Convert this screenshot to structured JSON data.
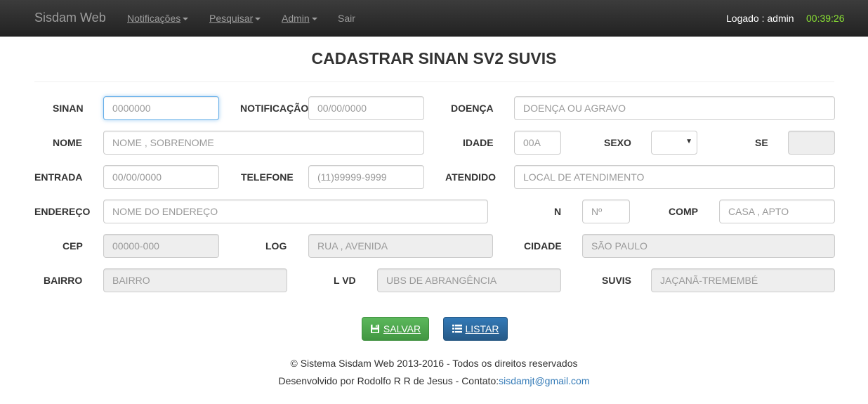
{
  "navbar": {
    "brand": "Sisdam Web",
    "menu": [
      {
        "label": "Notificações",
        "dropdown": true
      },
      {
        "label": "Pesquisar",
        "dropdown": true
      },
      {
        "label": "Admin",
        "dropdown": true
      },
      {
        "label": "Sair",
        "dropdown": false
      }
    ],
    "logged_text": "Logado : admin",
    "clock": "00:39:26"
  },
  "page": {
    "title": "CADASTRAR SINAN SV2 SUVIS"
  },
  "form": {
    "sinan": {
      "label": "SINAN",
      "placeholder": "0000000"
    },
    "notificacao": {
      "label": "NOTIFICAÇÃO",
      "placeholder": "00/00/0000"
    },
    "doenca": {
      "label": "DOENÇA",
      "placeholder": "DOENÇA OU AGRAVO"
    },
    "nome": {
      "label": "NOME",
      "placeholder": "NOME , SOBRENOME"
    },
    "idade": {
      "label": "IDADE",
      "placeholder": "00A"
    },
    "sexo": {
      "label": "SEXO",
      "value": ""
    },
    "se": {
      "label": "SE",
      "value": ""
    },
    "entrada": {
      "label": "ENTRADA",
      "placeholder": "00/00/0000"
    },
    "telefone": {
      "label": "TELEFONE",
      "placeholder": "(11)99999-9999"
    },
    "atendido": {
      "label": "ATENDIDO",
      "placeholder": "LOCAL DE ATENDIMENTO"
    },
    "endereco": {
      "label": "ENDEREÇO",
      "placeholder": "NOME DO ENDEREÇO"
    },
    "n": {
      "label": "N",
      "placeholder": "Nº"
    },
    "comp": {
      "label": "COMP",
      "placeholder": "CASA , APTO"
    },
    "cep": {
      "label": "CEP",
      "placeholder": "00000-000"
    },
    "log": {
      "label": "LOG",
      "placeholder": "RUA , AVENIDA"
    },
    "cidade": {
      "label": "CIDADE",
      "placeholder": "SÃO PAULO"
    },
    "bairro": {
      "label": "BAIRRO",
      "placeholder": "BAIRRO"
    },
    "lvd": {
      "label": "L VD",
      "placeholder": "UBS DE ABRANGÊNCIA"
    },
    "suvis": {
      "label": "SUVIS",
      "placeholder": "JAÇANÃ-TREMEMBÉ"
    }
  },
  "buttons": {
    "salvar": {
      "label": "SALVAR",
      "icon": "floppy-icon",
      "color": "#5cb85c"
    },
    "listar": {
      "label": "LISTAR",
      "icon": "list-icon",
      "color": "#337ab7"
    }
  },
  "footer": {
    "copyright": "© Sistema Sisdam Web 2013-2016 - Todos os direitos reservados",
    "dev_prefix": "Desenvolvido por Rodolfo R R de Jesus - Contato:",
    "email": "sisdamjt@gmail.com"
  }
}
